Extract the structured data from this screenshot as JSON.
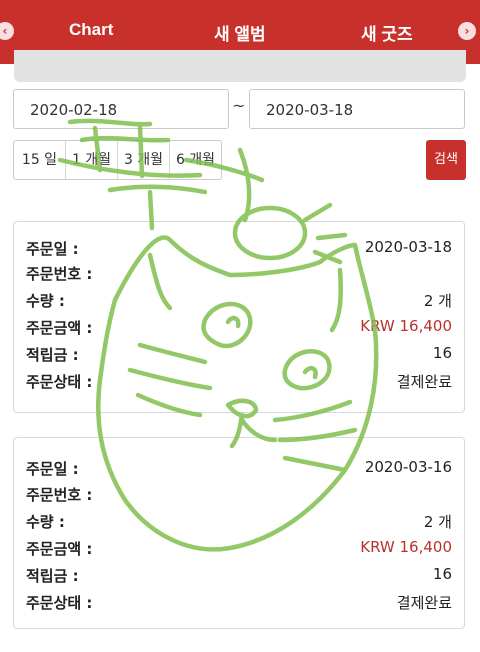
{
  "header": {
    "tabs": [
      "Chart",
      "새 앨범",
      "새 굿즈"
    ],
    "prev_icon": "chevron-left-icon",
    "next_icon": "chevron-right-icon",
    "accent_color": "#c8302c"
  },
  "filter": {
    "start_date": "2020-02-18",
    "separator": "~",
    "end_date": "2020-03-18",
    "periods": [
      "15 일",
      "1 개월",
      "3 개월",
      "6 개월"
    ],
    "search_label": "검색"
  },
  "orders": [
    {
      "labels": [
        "주문일 :",
        "주문번호 :",
        "수량 :",
        "주문금액 :",
        "적립금 :",
        "주문상태 :"
      ],
      "order_date": "2020-03-18",
      "order_number": "",
      "quantity": "2 개",
      "amount": "KRW 16,400",
      "points": "16",
      "status": "결제완료"
    },
    {
      "labels": [
        "주문일 :",
        "주문번호 :",
        "수량 :",
        "주문금액 :",
        "적립금 :",
        "주문상태 :"
      ],
      "order_date": "2020-03-16",
      "order_number": "",
      "quantity": "2 개",
      "amount": "KRW 16,400",
      "points": "16",
      "status": "결제완료"
    }
  ]
}
